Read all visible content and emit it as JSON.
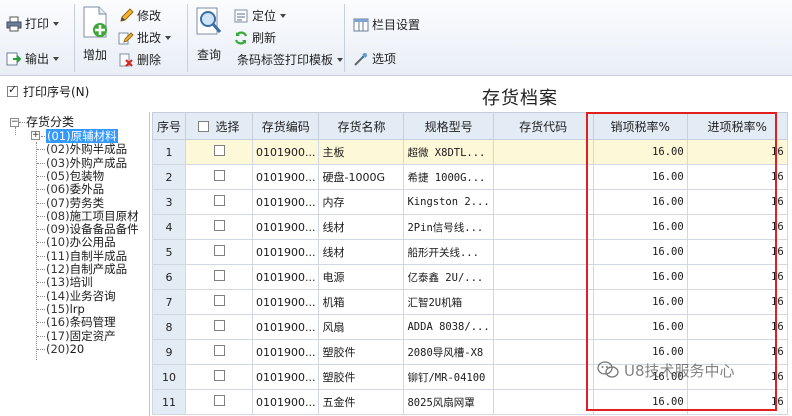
{
  "toolbar": {
    "print": "打印",
    "export": "输出",
    "add": "增加",
    "modify": "修改",
    "batch_modify": "批改",
    "delete": "删除",
    "query": "查询",
    "locate": "定位",
    "refresh": "刷新",
    "barcode_template": "条码标签打印模板",
    "column_settings": "栏目设置",
    "options": "选项"
  },
  "options_row": {
    "print_serial_label": "打印序号(N)",
    "print_serial_checked": true
  },
  "page_title": "存货档案",
  "tree": {
    "root": "存货分类",
    "items": [
      {
        "code": "(01)",
        "name": "原辅材料"
      },
      {
        "code": "(02)",
        "name": "外购半成品"
      },
      {
        "code": "(03)",
        "name": "外购产成品"
      },
      {
        "code": "(05)",
        "name": "包装物"
      },
      {
        "code": "(06)",
        "name": "委外品"
      },
      {
        "code": "(07)",
        "name": "劳务类"
      },
      {
        "code": "(08)",
        "name": "施工项目原材"
      },
      {
        "code": "(09)",
        "name": "设备备品备件"
      },
      {
        "code": "(10)",
        "name": "办公用品"
      },
      {
        "code": "(11)",
        "name": "自制半成品"
      },
      {
        "code": "(12)",
        "name": "自制产成品"
      },
      {
        "code": "(13)",
        "name": "培训"
      },
      {
        "code": "(14)",
        "name": "业务咨询"
      },
      {
        "code": "(15)",
        "name": "lrp"
      },
      {
        "code": "(16)",
        "name": "条码管理"
      },
      {
        "code": "(17)",
        "name": "固定资产"
      },
      {
        "code": "(20)",
        "name": "20"
      }
    ]
  },
  "grid": {
    "columns": [
      "序号",
      "选择",
      "存货编码",
      "存货名称",
      "规格型号",
      "存货代码",
      "销项税率%",
      "进项税率%"
    ],
    "rows": [
      {
        "no": "1",
        "code": "0101900...",
        "name": "主板",
        "spec": "超微 X8DTL...",
        "sale_tax": "16.00",
        "purchase_tax": "16"
      },
      {
        "no": "2",
        "code": "0101900...",
        "name": "硬盘-1000G",
        "spec": "希捷 1000G...",
        "sale_tax": "16.00",
        "purchase_tax": "16"
      },
      {
        "no": "3",
        "code": "0101900...",
        "name": "内存",
        "spec": "Kingston 2...",
        "sale_tax": "16.00",
        "purchase_tax": "16"
      },
      {
        "no": "4",
        "code": "0101900...",
        "name": "线材",
        "spec": "2Pin信号线...",
        "sale_tax": "16.00",
        "purchase_tax": "16"
      },
      {
        "no": "5",
        "code": "0101900...",
        "name": "线材",
        "spec": "船形开关线...",
        "sale_tax": "16.00",
        "purchase_tax": "16"
      },
      {
        "no": "6",
        "code": "0101900...",
        "name": "电源",
        "spec": "亿泰鑫 2U/...",
        "sale_tax": "16.00",
        "purchase_tax": "16"
      },
      {
        "no": "7",
        "code": "0101900...",
        "name": "机箱",
        "spec": "汇智2U机箱",
        "sale_tax": "16.00",
        "purchase_tax": "16"
      },
      {
        "no": "8",
        "code": "0101900...",
        "name": "风扇",
        "spec": "ADDA 8038/...",
        "sale_tax": "16.00",
        "purchase_tax": "16"
      },
      {
        "no": "9",
        "code": "0101900...",
        "name": "塑胶件",
        "spec": "2080导风槽-X8",
        "sale_tax": "16.00",
        "purchase_tax": "16"
      },
      {
        "no": "10",
        "code": "0101900...",
        "name": "塑胶件",
        "spec": "铆钉/MR-04100",
        "sale_tax": "16.00",
        "purchase_tax": "16"
      },
      {
        "no": "11",
        "code": "0101900...",
        "name": "五金件",
        "spec": "8025风扇网罩",
        "sale_tax": "16.00",
        "purchase_tax": "16"
      }
    ]
  },
  "watermark": "U8技术服务中心",
  "colors": {
    "selection": "#3399ff",
    "header_bg": "#e3ebf5",
    "highlight_box": "#e02020",
    "selected_row": "#fdf8d8"
  }
}
